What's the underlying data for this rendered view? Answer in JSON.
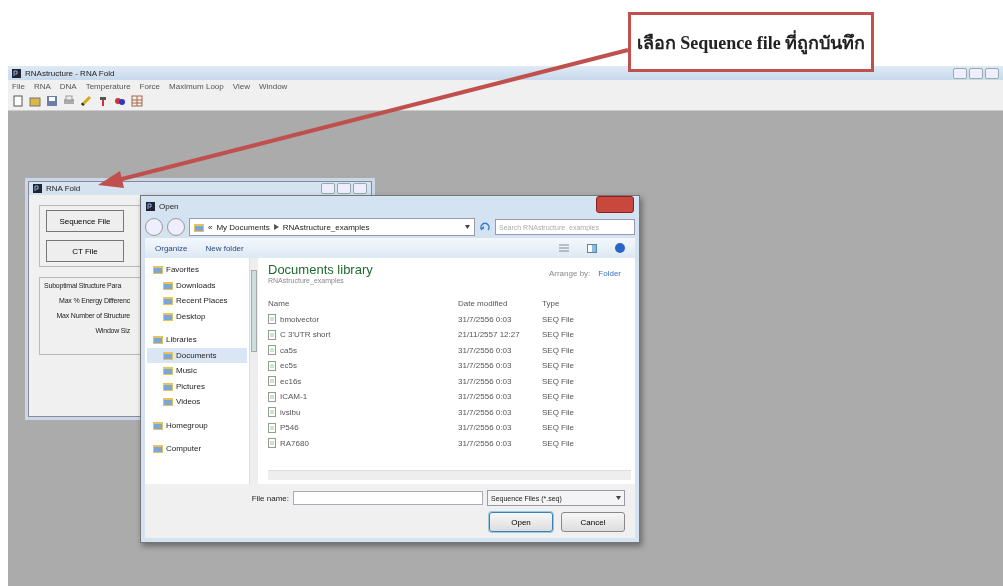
{
  "callout": {
    "text": "เลือก Sequence file ที่ถูกบันทึก"
  },
  "app": {
    "title": "RNAstructure - RNA Fold",
    "menu": [
      "File",
      "RNA",
      "DNA",
      "Temperature",
      "Force",
      "Maximum Loop",
      "View",
      "Window"
    ]
  },
  "rna_fold_window": {
    "title": "RNA Fold",
    "buttons": [
      "Sequence File",
      "CT File"
    ],
    "group_title": "Suboptimal Structure Para",
    "labels": [
      "Max % Energy Differenc",
      "Max Number of Structure",
      "Window Siz"
    ]
  },
  "open_dialog": {
    "title": "Open",
    "breadcrumb_overflow": "«",
    "breadcrumb": [
      "My Documents",
      "RNAstructure_examples"
    ],
    "search": {
      "placeholder": "Search RNAstructure_examples"
    },
    "toolbar": [
      "Organize",
      "New folder"
    ],
    "nav": [
      {
        "label": "Favorites",
        "selected": false,
        "children": [
          {
            "label": "Downloads",
            "selected": false
          },
          {
            "label": "Recent Places",
            "selected": false
          },
          {
            "label": "Desktop",
            "selected": false
          }
        ]
      },
      {
        "label": "Libraries",
        "selected": false,
        "children": [
          {
            "label": "Documents",
            "selected": true
          },
          {
            "label": "Music",
            "selected": false
          },
          {
            "label": "Pictures",
            "selected": false
          },
          {
            "label": "Videos",
            "selected": false
          }
        ]
      },
      {
        "label": "Homegroup",
        "selected": false
      },
      {
        "label": "Computer",
        "selected": false
      }
    ],
    "library_title": "Documents library",
    "library_subtitle": "RNAstructure_examples",
    "arrange_label": "Arrange by:",
    "arrange_value": "Folder",
    "columns": [
      "Name",
      "Date modified",
      "Type"
    ],
    "rows": [
      [
        "bmoivector",
        "31/7/2556 0:03",
        "SEQ File"
      ],
      [
        "C 3'UTR short",
        "21/11/2557 12:27",
        "SEQ File"
      ],
      [
        "ca5s",
        "31/7/2556 0:03",
        "SEQ File"
      ],
      [
        "ec5s",
        "31/7/2556 0:03",
        "SEQ File"
      ],
      [
        "ec16s",
        "31/7/2556 0:03",
        "SEQ File"
      ],
      [
        "ICAM-1",
        "31/7/2556 0:03",
        "SEQ File"
      ],
      [
        "ivslbu",
        "31/7/2556 0:03",
        "SEQ File"
      ],
      [
        "P546",
        "31/7/2556 0:03",
        "SEQ File"
      ],
      [
        "RA7680",
        "31/7/2556 0:03",
        "SEQ File"
      ]
    ],
    "file_name_label": "File name:",
    "file_type": "Sequence Files (*.seq)",
    "buttons": [
      "Open",
      "Cancel"
    ]
  }
}
